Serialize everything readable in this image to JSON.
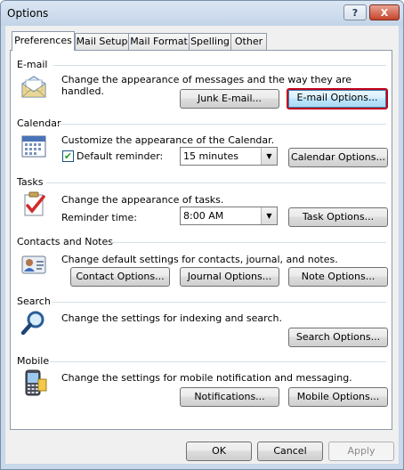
{
  "window": {
    "title": "Options",
    "help_label": "?",
    "close_label": "X"
  },
  "tabs": [
    {
      "label": "Preferences",
      "active": true
    },
    {
      "label": "Mail Setup"
    },
    {
      "label": "Mail Format"
    },
    {
      "label": "Spelling"
    },
    {
      "label": "Other"
    }
  ],
  "sections": {
    "email": {
      "title": "E-mail",
      "description": "Change the appearance of messages and the way they are handled.",
      "junk_button": "Junk E-mail...",
      "options_button": "E-mail Options...",
      "icon": "envelope-icon"
    },
    "calendar": {
      "title": "Calendar",
      "description": "Customize the appearance of the Calendar.",
      "reminder_label": "Default reminder:",
      "reminder_checked": true,
      "reminder_value": "15 minutes",
      "options_button": "Calendar Options...",
      "icon": "calendar-icon"
    },
    "tasks": {
      "title": "Tasks",
      "description": "Change the appearance of tasks.",
      "reminder_label": "Reminder time:",
      "reminder_value": "8:00 AM",
      "options_button": "Task Options...",
      "icon": "clipboard-check-icon"
    },
    "contacts": {
      "title": "Contacts and Notes",
      "description": "Change default settings for contacts, journal, and notes.",
      "contact_button": "Contact Options...",
      "journal_button": "Journal Options...",
      "note_button": "Note Options...",
      "icon": "contact-card-icon"
    },
    "search": {
      "title": "Search",
      "description": "Change the settings for indexing and search.",
      "options_button": "Search Options...",
      "icon": "magnifier-icon"
    },
    "mobile": {
      "title": "Mobile",
      "description": "Change the settings for mobile notification and messaging.",
      "notifications_button": "Notifications...",
      "mobile_button": "Mobile Options...",
      "icon": "mobile-device-icon"
    }
  },
  "footer": {
    "ok": "OK",
    "cancel": "Cancel",
    "apply": "Apply"
  }
}
